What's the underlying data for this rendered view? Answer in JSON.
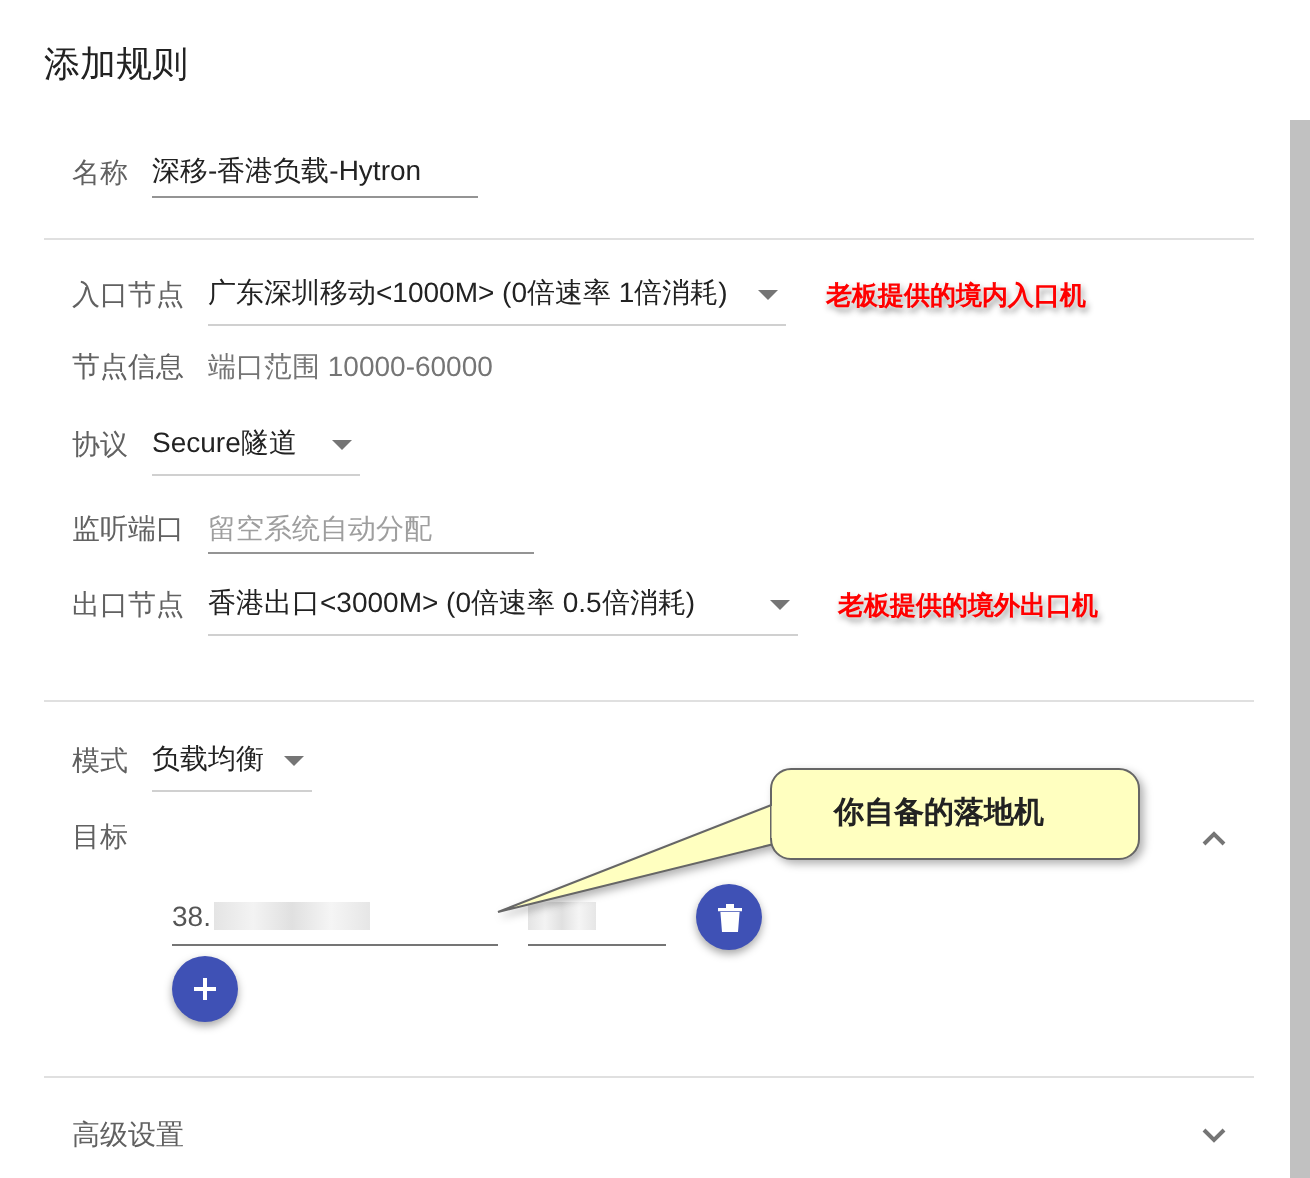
{
  "dialog": {
    "title": "添加规则"
  },
  "name": {
    "label": "名称",
    "value": "深移-香港负载-Hytron"
  },
  "entry_node": {
    "label": "入口节点",
    "value": "广东深圳移动<1000M> (0倍速率 1倍消耗)",
    "annotation": "老板提供的境内入口机"
  },
  "node_info": {
    "label": "节点信息",
    "value": "端口范围 10000-60000"
  },
  "protocol": {
    "label": "协议",
    "value": "Secure隧道"
  },
  "listen_port": {
    "label": "监听端口",
    "placeholder": "留空系统自动分配"
  },
  "exit_node": {
    "label": "出口节点",
    "value": "香港出口<3000M> (0倍速率 0.5倍消耗)",
    "annotation": "老板提供的境外出口机"
  },
  "mode": {
    "label": "模式",
    "value": "负载均衡"
  },
  "target": {
    "label": "目标",
    "expanded": true,
    "address": "38.",
    "callout": "你自备的落地机"
  },
  "advanced": {
    "label": "高级设置",
    "expanded": false
  }
}
